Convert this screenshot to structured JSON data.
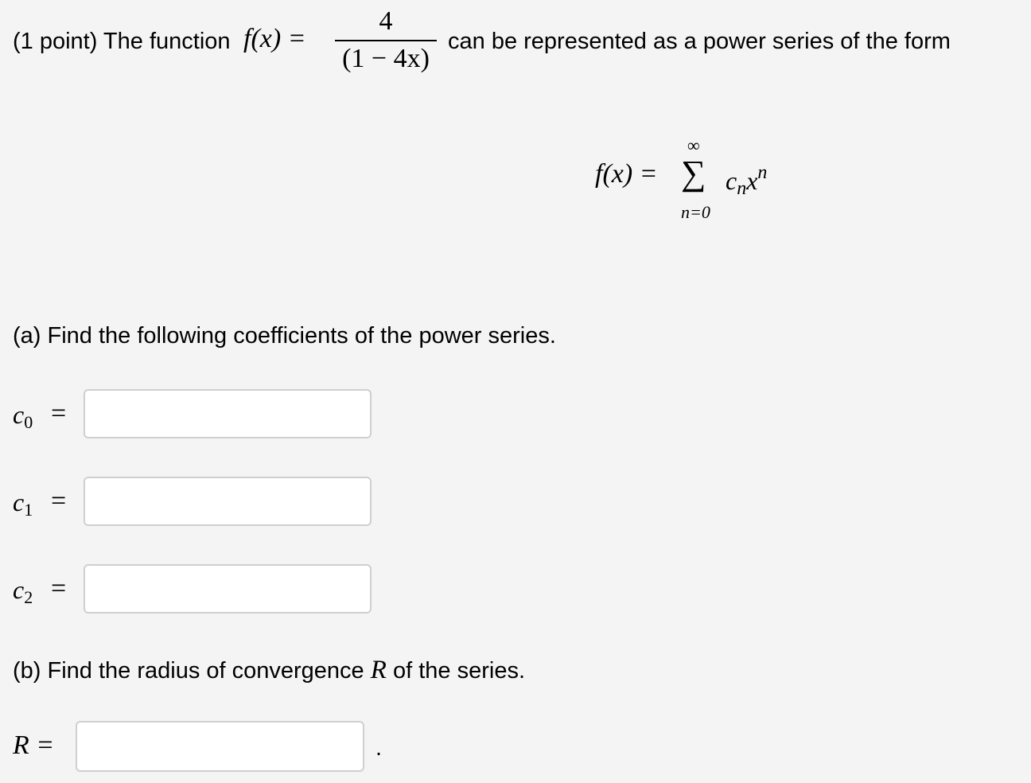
{
  "problem": {
    "intro_text": "(1 point) The function",
    "function_lhs": "f(x) =",
    "fraction_numerator": "4",
    "fraction_denominator": "(1 − 4x)",
    "intro_tail": "can be represented as a power series of the form"
  },
  "series": {
    "lhs": "f(x) =",
    "sigma": "∑",
    "upper_limit": "∞",
    "lower_limit": "n=0",
    "term_base": "c",
    "term_sub": "n",
    "term_var": "x",
    "term_sup": "n"
  },
  "part_a": {
    "heading": "(a) Find the following coefficients of the power series.",
    "coefficients": [
      {
        "symbol": "c",
        "index": "0",
        "equals": "=",
        "value": "",
        "placeholder": ""
      },
      {
        "symbol": "c",
        "index": "1",
        "equals": "=",
        "value": "",
        "placeholder": ""
      },
      {
        "symbol": "c",
        "index": "2",
        "equals": "=",
        "value": "",
        "placeholder": ""
      }
    ]
  },
  "part_b": {
    "heading_before": "(b) Find the radius of convergence",
    "heading_symbol": "R",
    "heading_after": "of the series.",
    "answer_label": "R =",
    "value": "",
    "placeholder": "",
    "trailing_punct": "."
  }
}
